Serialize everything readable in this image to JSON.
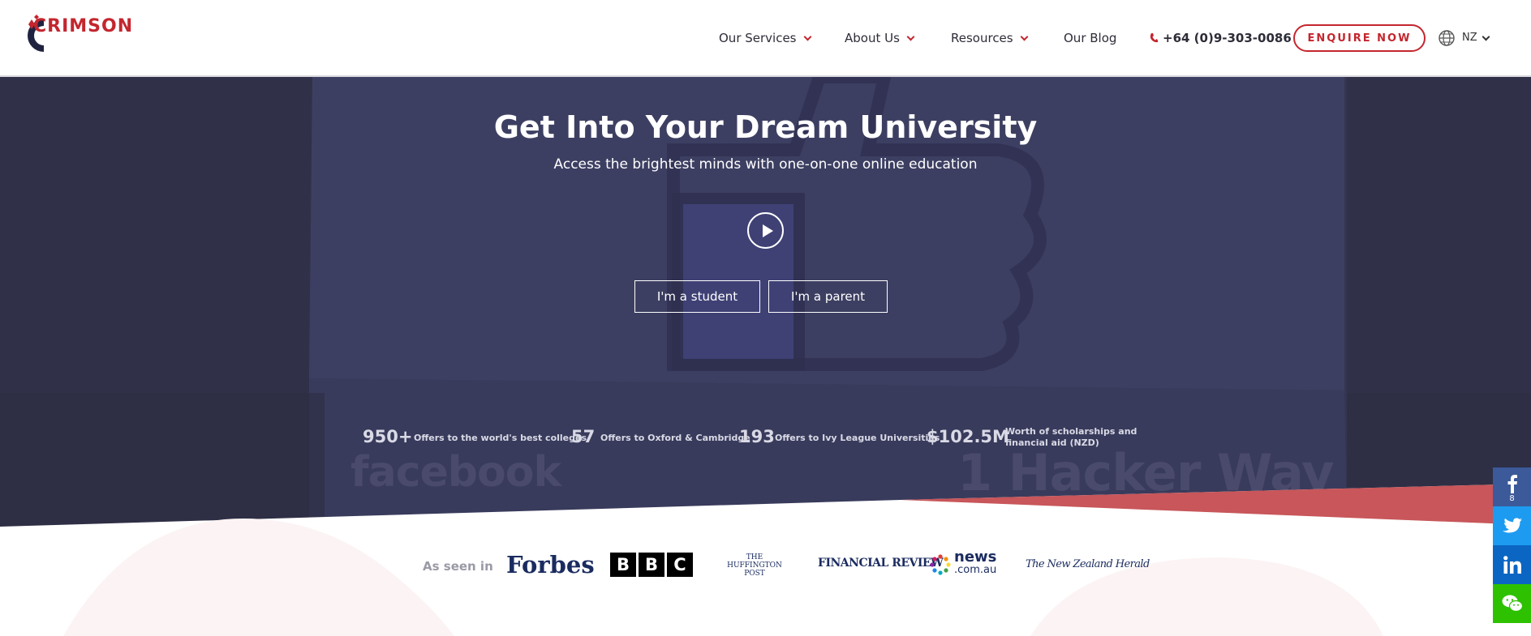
{
  "brand": {
    "name": "CRIMSON",
    "accent": "#c4262e"
  },
  "nav": {
    "items": [
      {
        "label": "Our Services",
        "has_dropdown": true
      },
      {
        "label": "About Us",
        "has_dropdown": true
      },
      {
        "label": "Resources",
        "has_dropdown": true
      },
      {
        "label": "Our Blog",
        "has_dropdown": false
      }
    ],
    "phone": "+64 (0)9-303-0086",
    "enquire_label": "ENQUIRE NOW",
    "locale": "NZ"
  },
  "hero": {
    "title": "Get Into Your Dream University",
    "subtitle": "Access the brightest minds with one-on-one online education",
    "cta_student": "I'm a student",
    "cta_parent": "I'm a parent",
    "background_color": "#3a3c5c",
    "background_signage": [
      "facebook",
      "1 Hacker Way"
    ],
    "stats": [
      {
        "value": "950+",
        "label": "Offers to the world's best colleges"
      },
      {
        "value": "57",
        "label": "Offers to Oxford & Cambridge"
      },
      {
        "value": "193",
        "label": "Offers to Ivy League Universities"
      },
      {
        "value": "$102.5M",
        "label": "Worth of scholarships and financial aid (NZD)"
      }
    ]
  },
  "press": {
    "label": "As seen in",
    "outlets": [
      {
        "name": "Forbes"
      },
      {
        "name": "BBC",
        "letters": [
          "B",
          "B",
          "C"
        ]
      },
      {
        "name": "The Huffington Post",
        "lines": [
          "THE",
          "HUFFINGTON",
          "POST"
        ]
      },
      {
        "name": "FINANCIAL REVIEW"
      },
      {
        "name": "news.com.au",
        "word": "news",
        "suffix": ".com.au"
      },
      {
        "name": "The New Zealand Herald"
      }
    ]
  },
  "social": {
    "facebook_count": "8",
    "buttons": [
      "facebook-icon",
      "twitter-icon",
      "linkedin-icon",
      "wechat-icon"
    ]
  }
}
